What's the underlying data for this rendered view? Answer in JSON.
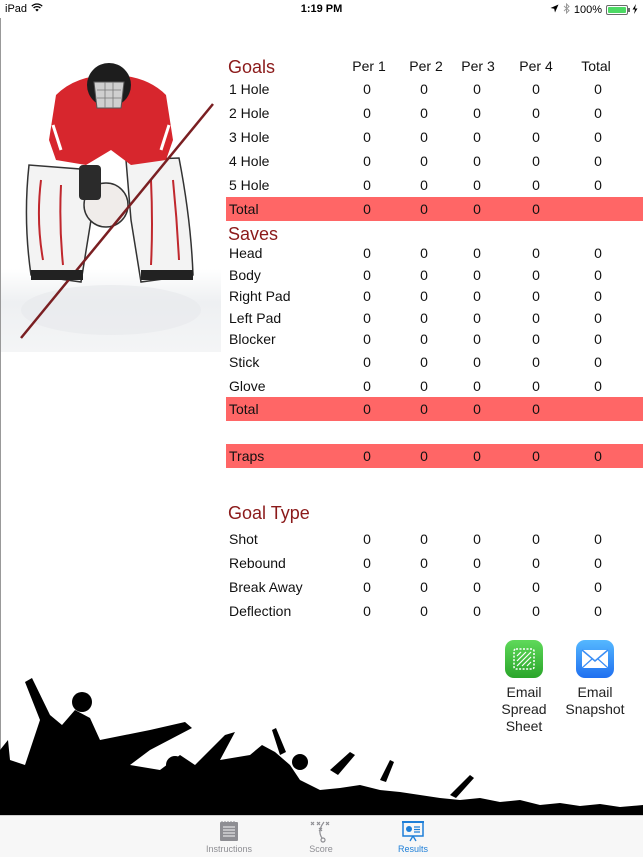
{
  "status_bar": {
    "device": "iPad",
    "time": "1:19 PM",
    "battery": "100%",
    "battery_level_percent": 100
  },
  "columns": [
    "Per 1",
    "Per 2",
    "Per 3",
    "Per 4",
    "Total"
  ],
  "goals": {
    "title": "Goals",
    "rows": [
      {
        "label": "1 Hole",
        "values": [
          "0",
          "0",
          "0",
          "0",
          "0"
        ]
      },
      {
        "label": "2 Hole",
        "values": [
          "0",
          "0",
          "0",
          "0",
          "0"
        ]
      },
      {
        "label": "3 Hole",
        "values": [
          "0",
          "0",
          "0",
          "0",
          "0"
        ]
      },
      {
        "label": "4 Hole",
        "values": [
          "0",
          "0",
          "0",
          "0",
          "0"
        ]
      },
      {
        "label": "5 Hole",
        "values": [
          "0",
          "0",
          "0",
          "0",
          "0"
        ]
      }
    ],
    "total": {
      "label": "Total",
      "values": [
        "0",
        "0",
        "0",
        "0"
      ]
    }
  },
  "saves": {
    "title": "Saves",
    "rows": [
      {
        "label": "Head",
        "values": [
          "0",
          "0",
          "0",
          "0",
          "0"
        ]
      },
      {
        "label": "Body",
        "values": [
          "0",
          "0",
          "0",
          "0",
          "0"
        ]
      },
      {
        "label": "Right Pad",
        "values": [
          "0",
          "0",
          "0",
          "0",
          "0"
        ]
      },
      {
        "label": "Left Pad",
        "values": [
          "0",
          "0",
          "0",
          "0",
          "0"
        ]
      },
      {
        "label": "Blocker",
        "values": [
          "0",
          "0",
          "0",
          "0",
          "0"
        ]
      },
      {
        "label": "Stick",
        "values": [
          "0",
          "0",
          "0",
          "0",
          "0"
        ]
      },
      {
        "label": "Glove",
        "values": [
          "0",
          "0",
          "0",
          "0",
          "0"
        ]
      }
    ],
    "total": {
      "label": "Total",
      "values": [
        "0",
        "0",
        "0",
        "0"
      ]
    }
  },
  "traps": {
    "label": "Traps",
    "values": [
      "0",
      "0",
      "0",
      "0",
      "0"
    ]
  },
  "goal_type": {
    "title": "Goal Type",
    "rows": [
      {
        "label": "Shot",
        "values": [
          "0",
          "0",
          "0",
          "0",
          "0"
        ]
      },
      {
        "label": "Rebound",
        "values": [
          "0",
          "0",
          "0",
          "0",
          "0"
        ]
      },
      {
        "label": "Break Away",
        "values": [
          "0",
          "0",
          "0",
          "0",
          "0"
        ]
      },
      {
        "label": "Deflection",
        "values": [
          "0",
          "0",
          "0",
          "0",
          "0"
        ]
      }
    ]
  },
  "actions": {
    "email_spreadsheet": {
      "line1": "Email",
      "line2": "Spread",
      "line3": "Sheet"
    },
    "email_snapshot": {
      "line1": "Email",
      "line2": "Snapshot"
    }
  },
  "tabs": [
    {
      "label": "Instructions",
      "icon": "notepad-icon"
    },
    {
      "label": "Score",
      "icon": "playbook-icon"
    },
    {
      "label": "Results",
      "icon": "presentation-icon",
      "active": true
    }
  ],
  "colors": {
    "section_title": "#8b1a1a",
    "highlight_row": "#ff6666",
    "active_tab": "#1e7fd8"
  }
}
